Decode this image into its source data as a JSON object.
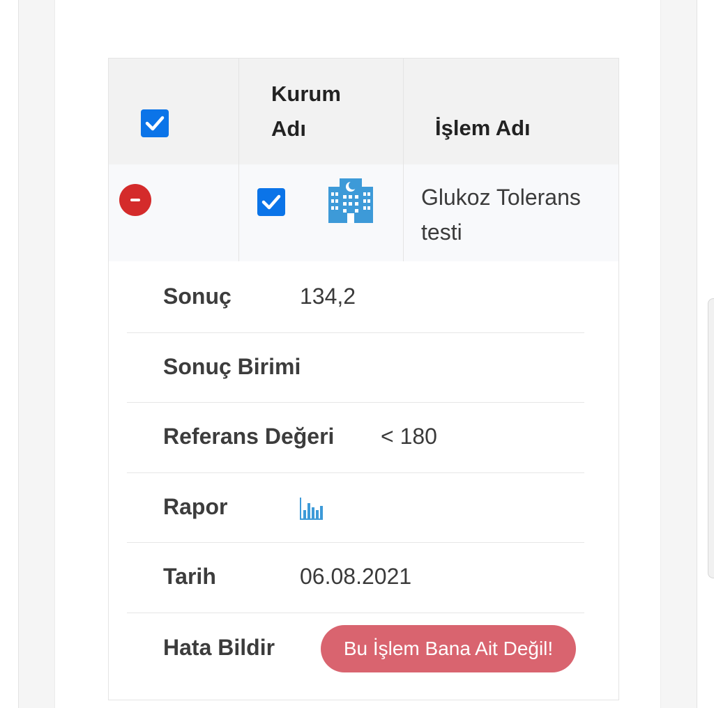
{
  "table": {
    "header": {
      "kurum_label_line1": "Kurum",
      "kurum_label_line2": "Adı",
      "islem_label": "İşlem Adı"
    },
    "row": {
      "islem_name_line1": "Glukoz Tolerans",
      "islem_name_line2": "testi",
      "institution_icon": "hospital-building-icon"
    }
  },
  "details": {
    "sonuc_label": "Sonuç",
    "sonuc_value": "134,2",
    "sonuc_birimi_label": "Sonuç Birimi",
    "sonuc_birimi_value": "",
    "referans_label": "Referans Değeri",
    "referans_value": "< 180",
    "rapor_label": "Rapor",
    "rapor_icon": "bar-chart-icon",
    "tarih_label": "Tarih",
    "tarih_value": "06.08.2021",
    "hata_label": "Hata Bildir",
    "hata_button": "Bu İşlem Bana Ait Değil!"
  },
  "colors": {
    "checkbox_blue": "#0b74e8",
    "remove_red": "#d42b2b",
    "report_button": "#d9646f",
    "icon_blue": "#3d9ad8"
  }
}
